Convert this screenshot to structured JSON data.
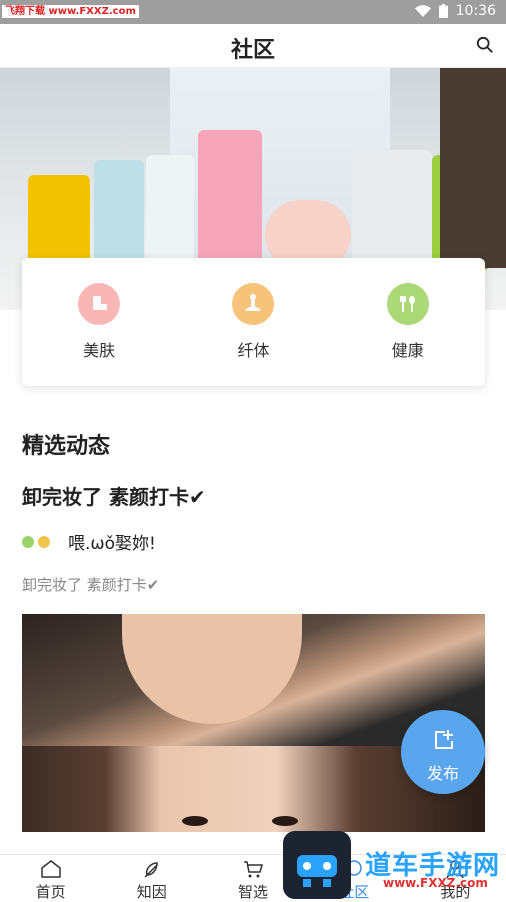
{
  "status": {
    "watermark": "飞翔下载 www.FXXZ.com",
    "time": "10:36"
  },
  "header": {
    "title": "社区",
    "search_icon": "search-icon"
  },
  "categories": [
    {
      "label": "美肤",
      "icon": "skincare-icon",
      "color": "#f29a9a"
    },
    {
      "label": "纤体",
      "icon": "yoga-icon",
      "color": "#f5b766"
    },
    {
      "label": "健康",
      "icon": "fork-spoon-icon",
      "color": "#9fd06a"
    }
  ],
  "feed": {
    "section_title": "精选动态",
    "post": {
      "title": "卸完妆了 素颜打卡✔",
      "username": "喂.ωǒ娶妳!",
      "content": "卸完妆了 素颜打卡✔"
    }
  },
  "fab": {
    "label": "发布"
  },
  "tabs": [
    {
      "label": "首页",
      "icon": "home-icon"
    },
    {
      "label": "知因",
      "icon": "knowledge-icon"
    },
    {
      "label": "智选",
      "icon": "cart-icon"
    },
    {
      "label": "社区",
      "icon": "community-icon"
    },
    {
      "label": "我的",
      "icon": "profile-icon"
    }
  ],
  "watermark_bottom": {
    "text": "道车手游网",
    "url": "www.FXXZ.com"
  },
  "colors": {
    "accent": "#3a8ee6",
    "fab": "#5aa6ee"
  }
}
